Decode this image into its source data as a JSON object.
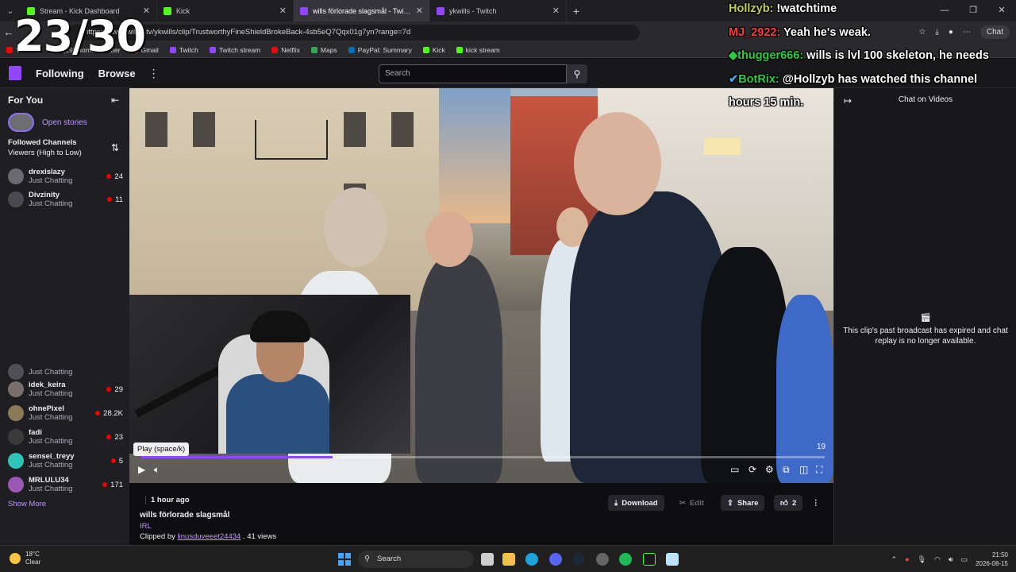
{
  "browser": {
    "tabs": [
      {
        "title": "Stream - Kick Dashboard",
        "icon": "kick"
      },
      {
        "title": "Kick",
        "icon": "kick"
      },
      {
        "title": "wills förlorade slagsmål - Twitch",
        "icon": "twitch"
      },
      {
        "title": "ykwills - Twitch",
        "icon": "twitch"
      }
    ],
    "url": "https://www.twitch.tv/ykwills/clip/TrustworthyFineShieldBrokeBack-4sb5eQ7Qqx01g7yn?range=7d",
    "copilot_label": "Chat",
    "bookmarks": [
      "YouTube",
      "(19) Home / Twitter",
      "Gmail",
      "Twitch",
      "Twitch stream",
      "Netflix",
      "Maps",
      "PayPal: Summary",
      "Kick",
      "kick stream"
    ]
  },
  "overlay_counter": "23/30",
  "twitch": {
    "nav": {
      "following": "Following",
      "browse": "Browse",
      "search_placeholder": "Search"
    },
    "sidebar": {
      "for_you": "For You",
      "open_stories": "Open stories",
      "followed_title": "Followed Channels",
      "followed_sort": "Viewers (High to Low)",
      "channels": [
        {
          "name": "drexislazy",
          "category": "Just Chatting",
          "viewers": "24"
        },
        {
          "name": "Divzinity",
          "category": "Just Chatting",
          "viewers": "11"
        },
        {
          "name": "",
          "category": "Just Chatting",
          "viewers": ""
        },
        {
          "name": "idek_keira",
          "category": "Just Chatting",
          "viewers": "29"
        },
        {
          "name": "ohnePixel",
          "category": "Just Chatting",
          "viewers": "28.2K"
        },
        {
          "name": "fadi",
          "category": "Just Chatting",
          "viewers": "23"
        },
        {
          "name": "sensei_treyy",
          "category": "Just Chatting",
          "viewers": "5"
        },
        {
          "name": "MRLULU34",
          "category": "Just Chatting",
          "viewers": "171"
        }
      ],
      "show_more": "Show More"
    },
    "player": {
      "tooltip": "Play (space/k)",
      "timestamp": "19",
      "progress": 0.28
    },
    "clip": {
      "ago": "1 hour ago",
      "title": "wills förlorade slagsmål",
      "category": "IRL",
      "clipped_by_prefix": "Clipped by",
      "clipper": "linusduveeet24434",
      "views": " . 41 views",
      "download": "Download",
      "edit": "Edit",
      "share": "Share",
      "likes": "2"
    },
    "chat": {
      "title": "Chat on Videos",
      "message": "This clip's past broadcast has expired and chat replay is no longer available."
    }
  },
  "overlay_chat": [
    {
      "user": "Hollzyb:",
      "text": " !watchtime"
    },
    {
      "user": "MJ_2922:",
      "text": " Yeah he's weak."
    },
    {
      "user": "thugger666:",
      "text": " wills is lvl 100 skeleton, he needs"
    },
    {
      "user": "BotRix:",
      "text": " @Hollzyb has watched this channel"
    },
    {
      "user": "",
      "text": "hours 15 min."
    }
  ],
  "taskbar": {
    "temp": "18°C",
    "condition": "Clear",
    "search": "Search",
    "time": "21:50",
    "date": "2026-08-15"
  },
  "colors": {
    "twitch_purple": "#9146ff",
    "kick_green": "#53fc18",
    "live_red": "#eb0400"
  }
}
